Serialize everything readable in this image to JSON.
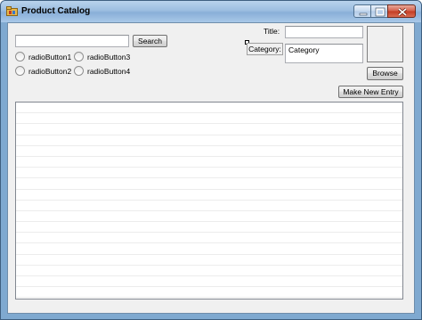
{
  "window": {
    "title": "Product Catalog",
    "icon": "app-folder-icon",
    "caption_buttons": [
      "minimize-icon",
      "maximize-icon",
      "close-icon"
    ]
  },
  "search": {
    "value": "",
    "button_label": "Search"
  },
  "radios": [
    {
      "label": "radioButton1",
      "checked": false
    },
    {
      "label": "radioButton3",
      "checked": false
    },
    {
      "label": "radioButton2",
      "checked": false
    },
    {
      "label": "radioButton4",
      "checked": false
    }
  ],
  "form": {
    "title_label": "Title:",
    "title_value": "",
    "category_label": "Category:",
    "category_value": "Category",
    "browse_label": "Browse",
    "new_entry_label": "Make New Entry"
  },
  "list": {
    "rows": []
  },
  "colors": {
    "titlebar": "#9cbde0",
    "client_bg": "#f0f0f0",
    "close_button": "#c23b22"
  }
}
